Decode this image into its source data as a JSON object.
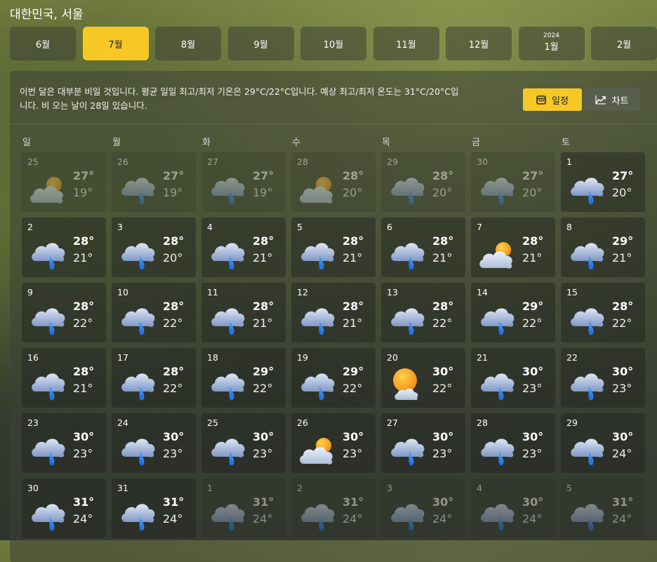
{
  "location": "대한민국, 서울",
  "months": [
    {
      "label": "6월",
      "year": "",
      "active": false
    },
    {
      "label": "7월",
      "year": "",
      "active": true
    },
    {
      "label": "8월",
      "year": "",
      "active": false
    },
    {
      "label": "9월",
      "year": "",
      "active": false
    },
    {
      "label": "10월",
      "year": "",
      "active": false
    },
    {
      "label": "11월",
      "year": "",
      "active": false
    },
    {
      "label": "12월",
      "year": "",
      "active": false
    },
    {
      "label": "1월",
      "year": "2024",
      "active": false
    },
    {
      "label": "2월",
      "year": "",
      "active": false
    }
  ],
  "summary": "이번 달은 대부분 비일 것입니다. 평균 일일 최고/최저 기온은 29°C/22°C입니다. 예상 최고/최저 온도는 31°C/20°C입니다. 비 오는 날이 28일 있습니다.",
  "view_toggle": {
    "schedule_label": "일정",
    "chart_label": "차트"
  },
  "weekdays": [
    "일",
    "월",
    "화",
    "수",
    "목",
    "금",
    "토"
  ],
  "days": [
    {
      "day": "25",
      "hi": "27°",
      "lo": "19°",
      "icon": "partly-cloudy-icon",
      "dim": true
    },
    {
      "day": "26",
      "hi": "27°",
      "lo": "19°",
      "icon": "rain-icon",
      "dim": true
    },
    {
      "day": "27",
      "hi": "27°",
      "lo": "19°",
      "icon": "rain-icon",
      "dim": true
    },
    {
      "day": "28",
      "hi": "28°",
      "lo": "20°",
      "icon": "partly-cloudy-icon",
      "dim": true
    },
    {
      "day": "29",
      "hi": "28°",
      "lo": "20°",
      "icon": "rain-icon",
      "dim": true
    },
    {
      "day": "30",
      "hi": "27°",
      "lo": "20°",
      "icon": "rain-icon",
      "dim": true
    },
    {
      "day": "1",
      "hi": "27°",
      "lo": "20°",
      "icon": "rain-icon",
      "dim": false
    },
    {
      "day": "2",
      "hi": "28°",
      "lo": "21°",
      "icon": "rain-icon",
      "dim": false
    },
    {
      "day": "3",
      "hi": "28°",
      "lo": "20°",
      "icon": "rain-icon",
      "dim": false
    },
    {
      "day": "4",
      "hi": "28°",
      "lo": "21°",
      "icon": "rain-icon",
      "dim": false
    },
    {
      "day": "5",
      "hi": "28°",
      "lo": "21°",
      "icon": "rain-icon",
      "dim": false
    },
    {
      "day": "6",
      "hi": "28°",
      "lo": "21°",
      "icon": "rain-icon",
      "dim": false
    },
    {
      "day": "7",
      "hi": "28°",
      "lo": "21°",
      "icon": "partly-cloudy-icon",
      "dim": false
    },
    {
      "day": "8",
      "hi": "29°",
      "lo": "21°",
      "icon": "rain-icon",
      "dim": false
    },
    {
      "day": "9",
      "hi": "28°",
      "lo": "22°",
      "icon": "rain-icon",
      "dim": false
    },
    {
      "day": "10",
      "hi": "28°",
      "lo": "22°",
      "icon": "rain-icon",
      "dim": false
    },
    {
      "day": "11",
      "hi": "28°",
      "lo": "21°",
      "icon": "rain-icon",
      "dim": false
    },
    {
      "day": "12",
      "hi": "28°",
      "lo": "21°",
      "icon": "rain-icon",
      "dim": false
    },
    {
      "day": "13",
      "hi": "28°",
      "lo": "22°",
      "icon": "rain-icon",
      "dim": false
    },
    {
      "day": "14",
      "hi": "29°",
      "lo": "22°",
      "icon": "rain-icon",
      "dim": false
    },
    {
      "day": "15",
      "hi": "28°",
      "lo": "22°",
      "icon": "rain-icon",
      "dim": false
    },
    {
      "day": "16",
      "hi": "28°",
      "lo": "21°",
      "icon": "rain-icon",
      "dim": false
    },
    {
      "day": "17",
      "hi": "28°",
      "lo": "22°",
      "icon": "rain-icon",
      "dim": false
    },
    {
      "day": "18",
      "hi": "29°",
      "lo": "22°",
      "icon": "rain-icon",
      "dim": false
    },
    {
      "day": "19",
      "hi": "29°",
      "lo": "22°",
      "icon": "rain-icon",
      "dim": false
    },
    {
      "day": "20",
      "hi": "30°",
      "lo": "22°",
      "icon": "mostly-sunny-icon",
      "dim": false
    },
    {
      "day": "21",
      "hi": "30°",
      "lo": "23°",
      "icon": "rain-icon",
      "dim": false
    },
    {
      "day": "22",
      "hi": "30°",
      "lo": "23°",
      "icon": "rain-icon",
      "dim": false
    },
    {
      "day": "23",
      "hi": "30°",
      "lo": "23°",
      "icon": "rain-icon",
      "dim": false
    },
    {
      "day": "24",
      "hi": "30°",
      "lo": "23°",
      "icon": "rain-icon",
      "dim": false
    },
    {
      "day": "25",
      "hi": "30°",
      "lo": "23°",
      "icon": "rain-icon",
      "dim": false
    },
    {
      "day": "26",
      "hi": "30°",
      "lo": "23°",
      "icon": "partly-cloudy-icon",
      "dim": false
    },
    {
      "day": "27",
      "hi": "30°",
      "lo": "23°",
      "icon": "rain-icon",
      "dim": false
    },
    {
      "day": "28",
      "hi": "30°",
      "lo": "23°",
      "icon": "rain-icon",
      "dim": false
    },
    {
      "day": "29",
      "hi": "30°",
      "lo": "24°",
      "icon": "rain-icon",
      "dim": false
    },
    {
      "day": "30",
      "hi": "31°",
      "lo": "24°",
      "icon": "rain-icon",
      "dim": false
    },
    {
      "day": "31",
      "hi": "31°",
      "lo": "24°",
      "icon": "rain-icon",
      "dim": false
    },
    {
      "day": "1",
      "hi": "31°",
      "lo": "24°",
      "icon": "rain-icon",
      "dim": true
    },
    {
      "day": "2",
      "hi": "31°",
      "lo": "24°",
      "icon": "rain-icon",
      "dim": true
    },
    {
      "day": "3",
      "hi": "30°",
      "lo": "24°",
      "icon": "rain-icon",
      "dim": true
    },
    {
      "day": "4",
      "hi": "30°",
      "lo": "24°",
      "icon": "rain-icon",
      "dim": true
    },
    {
      "day": "5",
      "hi": "31°",
      "lo": "24°",
      "icon": "rain-icon",
      "dim": true
    }
  ],
  "colors": {
    "accent": "#f7c825"
  }
}
